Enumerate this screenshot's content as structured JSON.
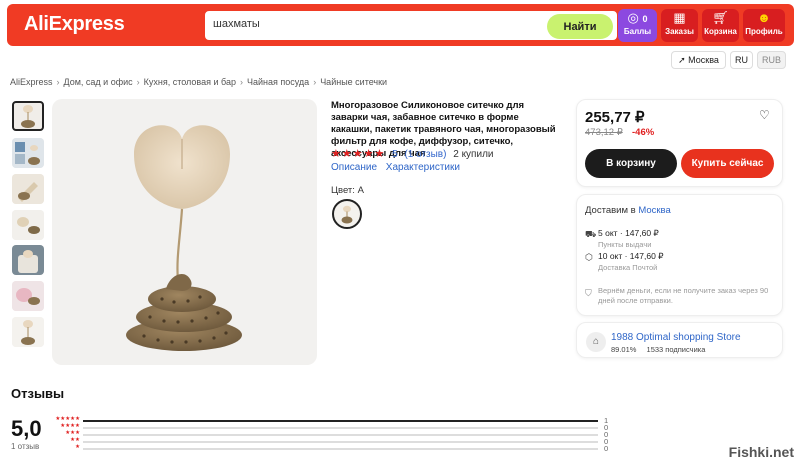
{
  "header": {
    "logo": "AliExpress",
    "search_value": "шахматы",
    "search_button": "Найти",
    "points": {
      "value": "0",
      "label": "Баллы"
    },
    "orders_label": "Заказы",
    "cart_label": "Корзина",
    "profile_label": "Профиль"
  },
  "locale": {
    "city": "Москва",
    "lang": "RU",
    "currency": "RUB"
  },
  "breadcrumb": [
    "AliExpress",
    "Дом, сад и офис",
    "Кухня, столовая и бар",
    "Чайная посуда",
    "Чайные ситечки"
  ],
  "product": {
    "title": "Многоразовое Силиконовое ситечко для заварки чая, забавное ситечко в форме какашки, пакетик травяного чая, многоразовый фильтр для кофе, диффузор, ситечко, аксессуары для чая",
    "stars": "★★★★★",
    "rating": "5",
    "reviews_link": "(1 отзыв)",
    "bought": "2 купили",
    "tab_description": "Описание",
    "tab_specs": "Характеристики",
    "color_label": "Цвет: A"
  },
  "buy": {
    "price": "255,77 ₽",
    "old_price": "473,12 ₽",
    "discount": "-46%",
    "cart_button": "В корзину",
    "buy_button": "Купить сейчас"
  },
  "delivery": {
    "title_prefix": "Доставим в",
    "city": "Москва",
    "option1_title": "5 окт · 147,60 ₽",
    "option1_sub": "Пункты выдачи",
    "option2_title": "10 окт · 147,60 ₽",
    "option2_sub": "Доставка Почтой",
    "refund_text": "Вернём деньги, если не получите заказ через 90 дней после отправки."
  },
  "store": {
    "name": "1988 Optimal shopping Store",
    "rating": "89.01%",
    "subscribers": "1533 подписчика"
  },
  "reviews": {
    "title": "Отзывы",
    "score": "5,0",
    "count_label": "1 отзыв",
    "distribution": [
      {
        "stars": "★★★★★",
        "count": "1",
        "fraction": 1.0
      },
      {
        "stars": "★★★★",
        "count": "0",
        "fraction": 0
      },
      {
        "stars": "★★★",
        "count": "0",
        "fraction": 0
      },
      {
        "stars": "★★",
        "count": "0",
        "fraction": 0
      },
      {
        "stars": "★",
        "count": "0",
        "fraction": 0
      }
    ]
  },
  "watermark": "Fishki.net",
  "colors": {
    "brand_red": "#f03b24",
    "buy_red": "#e8321e",
    "link_blue": "#2f66c8",
    "search_green": "#c9f26f",
    "points_purple": "#8c49e0"
  }
}
